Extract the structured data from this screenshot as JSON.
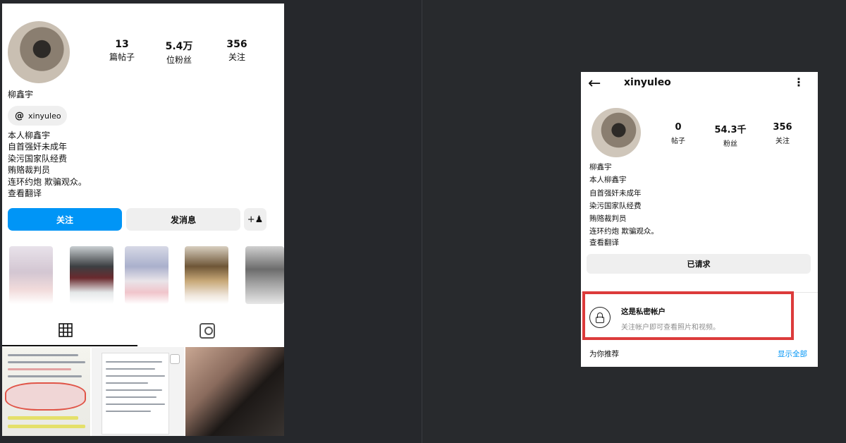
{
  "left_profile": {
    "stats": [
      {
        "value": "13",
        "label": "篇帖子"
      },
      {
        "value": "5.4万",
        "label": "位粉丝"
      },
      {
        "value": "356",
        "label": "关注"
      }
    ],
    "display_name": "柳鑫宇",
    "threads_handle": "xinyuleo",
    "bio_lines": [
      "本人柳鑫宇",
      "自首强奸未成年",
      "染污国家队经费",
      "贿赂裁判员",
      "连环约炮 欺骗观众。"
    ],
    "translate_link": "查看翻译",
    "buttons": {
      "follow": "关注",
      "message": "发消息",
      "add_user_icon": "person-add-icon"
    },
    "tabs": {
      "grid_icon": "grid-icon",
      "tagged_icon": "tagged-icon"
    }
  },
  "right_profile": {
    "username": "xinyuleo",
    "stats": [
      {
        "value": "0",
        "label": "帖子"
      },
      {
        "value": "54.3千",
        "label": "粉丝"
      },
      {
        "value": "356",
        "label": "关注"
      }
    ],
    "bio_lines": [
      "柳鑫宇",
      "本人柳鑫宇",
      "自首强奸未成年",
      "染污国家队经费",
      "贿赂裁判员",
      "连环约炮 欺骗观众。"
    ],
    "translate_link": "查看翻译",
    "requested_button": "已请求",
    "private": {
      "title": "这是私密帐户",
      "subtitle": "关注帐户即可查看照片和视频。"
    },
    "suggestions": {
      "label": "为你推荐",
      "show_all": "显示全部"
    }
  },
  "colors": {
    "accent": "#0095f6",
    "highlight_box": "#dc3b3b"
  }
}
